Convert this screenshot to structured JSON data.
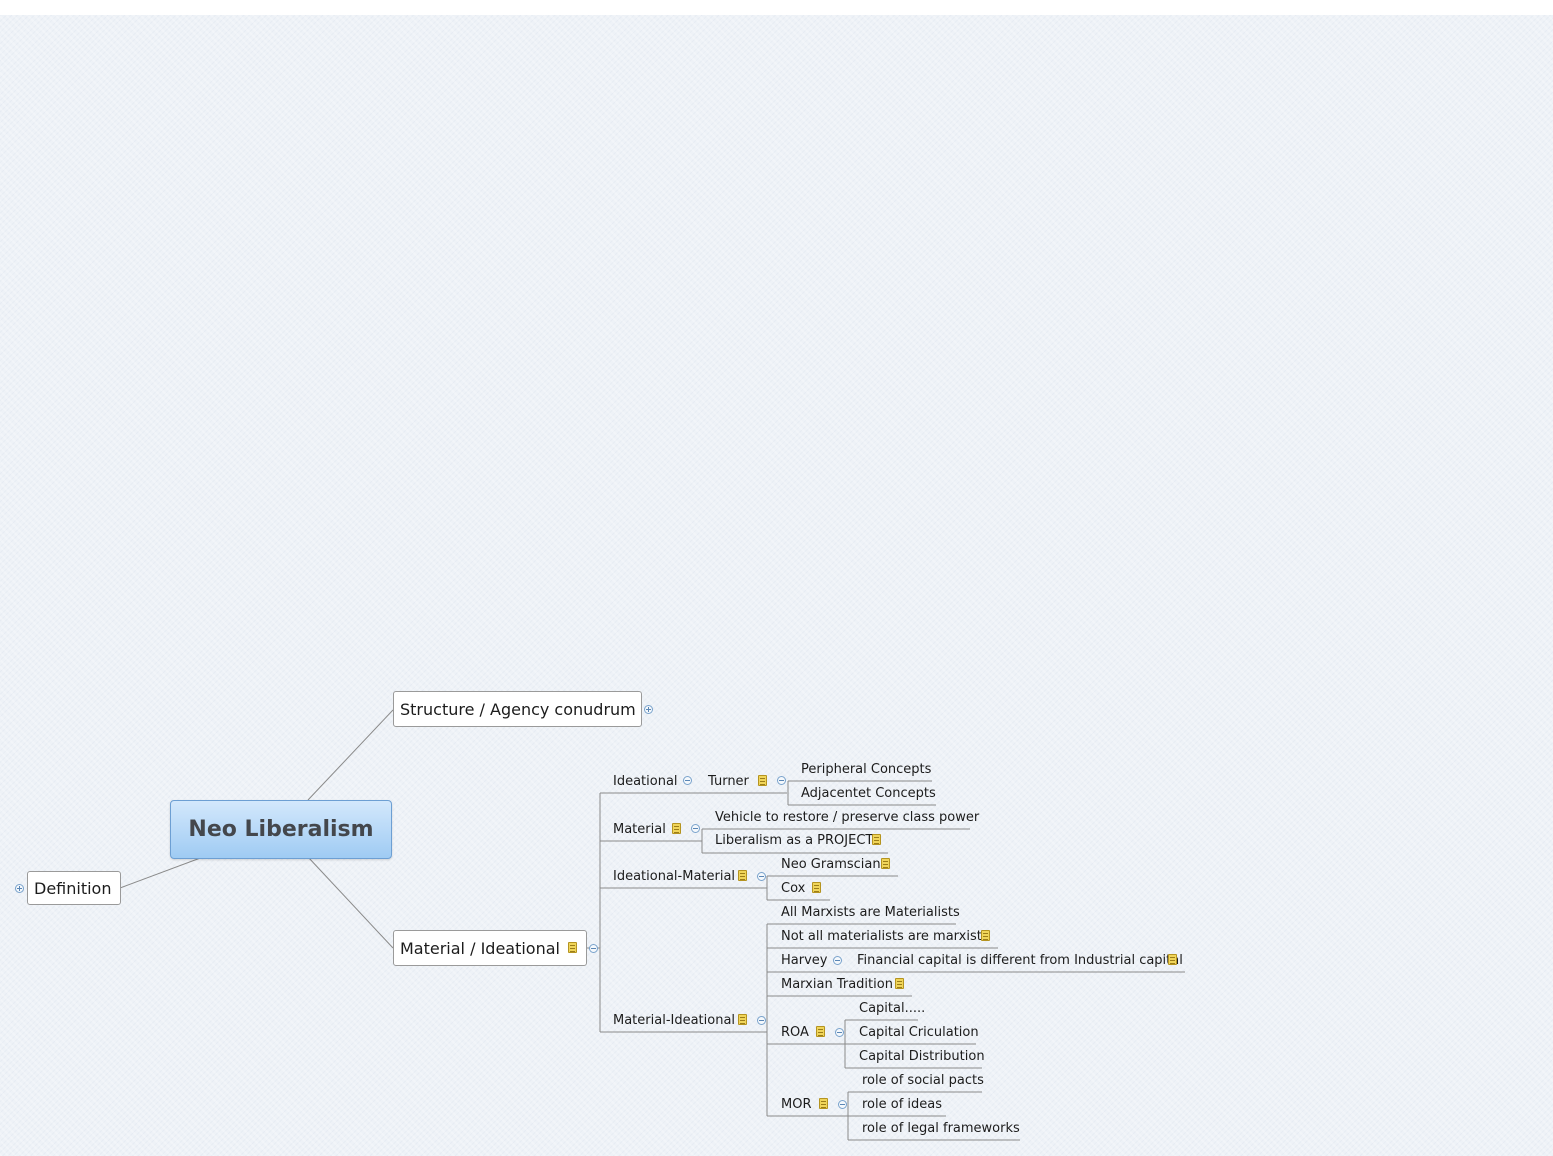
{
  "mindmap": {
    "central": "Neo Liberalism",
    "definition": "Definition",
    "structure_agency": "Structure / Agency conudrum",
    "material_ideational": "Material / Ideational",
    "ideational": "Ideational",
    "turner": "Turner",
    "peripheral_concepts": "Peripheral Concepts",
    "adjacentet_concepts": "Adjacentet Concepts",
    "material": "Material",
    "vehicle_class_power": "Vehicle to restore / preserve class power",
    "liberalism_project": "Liberalism as a PROJECT",
    "ideational_material": "Ideational-Material",
    "neo_gramscian": "Neo Gramscian",
    "cox": "Cox",
    "material_ideational_sub": "Material-Ideational",
    "all_marxists": "All Marxists are Materialists",
    "not_all_materialists": "Not all materialists are marxists",
    "harvey": "Harvey",
    "financial_capital": "Financial capital is different from Industrial capital",
    "marxian_tradition": "Marxian Tradition",
    "roa": "ROA",
    "capital_dots": "Capital.....",
    "capital_criculation": "Capital Criculation",
    "capital_distribution": "Capital Distribution",
    "mor": "MOR",
    "role_social_pacts": "role of social pacts",
    "role_ideas": "role of ideas",
    "role_legal_frameworks": "role of legal frameworks"
  },
  "colors": {
    "canvas": "#eef2f7",
    "central_fill": "#9fcbf3",
    "connector": "#7d7d7d",
    "note_icon": "#f0d55a"
  }
}
